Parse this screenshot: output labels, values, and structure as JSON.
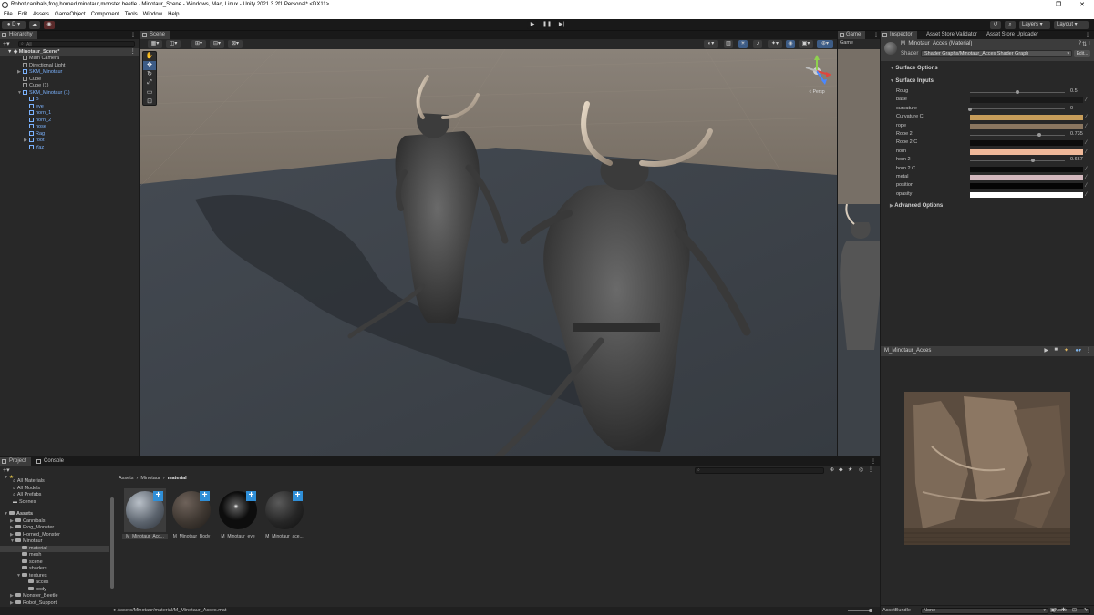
{
  "window": {
    "title": "Robot,canibals,frog,horned,minotaur,monster beetle - Minotaur_Scene - Windows, Mac, Linux - Unity 2021.3.2f1 Personal* <DX11>"
  },
  "menu": [
    "File",
    "Edit",
    "Assets",
    "GameObject",
    "Component",
    "Tools",
    "Window",
    "Help"
  ],
  "toolbar": {
    "account": "D",
    "layers_label": "Layers",
    "layout_label": "Layout"
  },
  "hierarchy": {
    "tab": "Hierarchy",
    "search_placeholder": "All",
    "scene": "Minotaur_Scene*",
    "items": [
      {
        "label": "Main Camera",
        "depth": 1,
        "blue": false,
        "arrow": ""
      },
      {
        "label": "Directional Light",
        "depth": 1,
        "blue": false,
        "arrow": ""
      },
      {
        "label": "SKM_Minotaur",
        "depth": 1,
        "blue": true,
        "arrow": "▶"
      },
      {
        "label": "Cube",
        "depth": 1,
        "blue": false,
        "arrow": ""
      },
      {
        "label": "Cube (1)",
        "depth": 1,
        "blue": false,
        "arrow": ""
      },
      {
        "label": "SKM_Minotaur (1)",
        "depth": 1,
        "blue": true,
        "arrow": "▼"
      },
      {
        "label": "B",
        "depth": 2,
        "blue": true,
        "arrow": ""
      },
      {
        "label": "eye",
        "depth": 2,
        "blue": true,
        "arrow": ""
      },
      {
        "label": "horn_1",
        "depth": 2,
        "blue": true,
        "arrow": ""
      },
      {
        "label": "horn_2",
        "depth": 2,
        "blue": true,
        "arrow": ""
      },
      {
        "label": "nose",
        "depth": 2,
        "blue": true,
        "arrow": ""
      },
      {
        "label": "Rag",
        "depth": 2,
        "blue": true,
        "arrow": ""
      },
      {
        "label": "root",
        "depth": 2,
        "blue": true,
        "arrow": "▶"
      },
      {
        "label": "Yaz",
        "depth": 2,
        "blue": true,
        "arrow": ""
      }
    ]
  },
  "scene": {
    "tab": "Scene",
    "game_tab": "Game",
    "game_display": "Game",
    "persp_label": "< Persp"
  },
  "inspector": {
    "tabs": [
      "Inspector",
      "Asset Store Validator",
      "Asset Store Uploader"
    ],
    "material_name": "M_Minotaur_Acces (Material)",
    "shader_label": "Shader",
    "shader_value": "Shader Graphs/Minotaur_Acces Shader Graph",
    "edit_button": "Edit...",
    "surface_options": "Surface Options",
    "surface_inputs": "Surface Inputs",
    "advanced_options": "Advanced Options",
    "properties": [
      {
        "label": "Roug",
        "type": "slider",
        "value": "0.5",
        "fraction": 0.5
      },
      {
        "label": "base",
        "type": "color",
        "color": "#1a1a1a"
      },
      {
        "label": "curvature",
        "type": "slider",
        "value": "0",
        "fraction": 0.0
      },
      {
        "label": "Curvature C",
        "type": "color",
        "color": "#c79d5a"
      },
      {
        "label": "rope",
        "type": "color",
        "color": "#8a7660"
      },
      {
        "label": "Rope 2",
        "type": "slider",
        "value": "0.735",
        "fraction": 0.735
      },
      {
        "label": "Rope 2 C",
        "type": "color",
        "color": "#0c0c0c"
      },
      {
        "label": "horn",
        "type": "color",
        "color": "#efb99a"
      },
      {
        "label": "horn 2",
        "type": "slider",
        "value": "0.667",
        "fraction": 0.667
      },
      {
        "label": "horn 2 C",
        "type": "color",
        "color": "#0c0c0c"
      },
      {
        "label": "metal",
        "type": "color",
        "color": "#d2b7bd"
      },
      {
        "label": "position",
        "type": "color",
        "color": "#050505"
      },
      {
        "label": "opasity",
        "type": "color",
        "color": "#ffffff"
      }
    ],
    "preview_title": "M_Minotaur_Acces",
    "assetbundle_label": "AssetBundle",
    "assetbundle_value": "None",
    "assetbundle_variant": "None"
  },
  "project": {
    "tabs": [
      "Project",
      "Console"
    ],
    "favorites": [
      "All Materials",
      "All Models",
      "All Prefabs",
      "Scenes"
    ],
    "tree": [
      {
        "label": "Assets",
        "depth": 0,
        "arrow": "▼",
        "bold": true
      },
      {
        "label": "Cannibals",
        "depth": 1,
        "arrow": "▶"
      },
      {
        "label": "Frog_Monster",
        "depth": 1,
        "arrow": "▶"
      },
      {
        "label": "Horned_Monster",
        "depth": 1,
        "arrow": "▶"
      },
      {
        "label": "Minotaur",
        "depth": 1,
        "arrow": "▼"
      },
      {
        "label": "material",
        "depth": 2,
        "arrow": "",
        "selected": true
      },
      {
        "label": "mesh",
        "depth": 2,
        "arrow": ""
      },
      {
        "label": "scene",
        "depth": 2,
        "arrow": ""
      },
      {
        "label": "shaders",
        "depth": 2,
        "arrow": ""
      },
      {
        "label": "textures",
        "depth": 2,
        "arrow": "▼"
      },
      {
        "label": "acces",
        "depth": 3,
        "arrow": ""
      },
      {
        "label": "body",
        "depth": 3,
        "arrow": ""
      },
      {
        "label": "Monster_Beetle",
        "depth": 1,
        "arrow": "▶"
      },
      {
        "label": "Robot_Support",
        "depth": 1,
        "arrow": "▶"
      }
    ],
    "breadcrumb": [
      "Assets",
      "Minotaur",
      "material"
    ],
    "assets": [
      {
        "label": "M_Minotaur_Acc...",
        "style": "acces"
      },
      {
        "label": "M_Minotaur_Body",
        "style": "body"
      },
      {
        "label": "M_Minotaur_eye",
        "style": "eye"
      },
      {
        "label": "M_Minotaur_ace...",
        "style": "dark"
      }
    ],
    "path": "Assets/Minotaur/material/M_Minotaur_Acces.mat"
  }
}
